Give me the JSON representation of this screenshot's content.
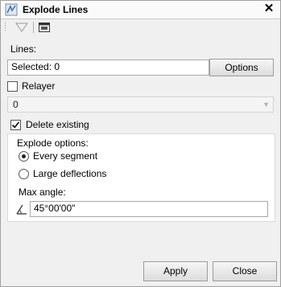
{
  "window": {
    "title": "Explode Lines",
    "close_glyph": "✕"
  },
  "lines": {
    "label": "Lines:",
    "selected_value": "Selected: 0",
    "options_label": "Options"
  },
  "relayer": {
    "label": "Relayer",
    "checked": false,
    "layer_value": "0"
  },
  "delete_existing": {
    "label": "Delete existing",
    "checked": true
  },
  "explode_options": {
    "label": "Explode options:",
    "choices": [
      {
        "label": "Every segment",
        "selected": true
      },
      {
        "label": "Large deflections",
        "selected": false
      }
    ]
  },
  "max_angle": {
    "label": "Max angle:",
    "value": "45°00'00\""
  },
  "footer": {
    "apply_label": "Apply",
    "close_label": "Close"
  },
  "icons": {
    "title": "explode-lines-icon",
    "filter": "filter-icon",
    "toolbar_window": "window-icon",
    "angle": "angle-icon",
    "checkmark": "checkmark-icon",
    "dropdown": "chevron-down-icon"
  }
}
